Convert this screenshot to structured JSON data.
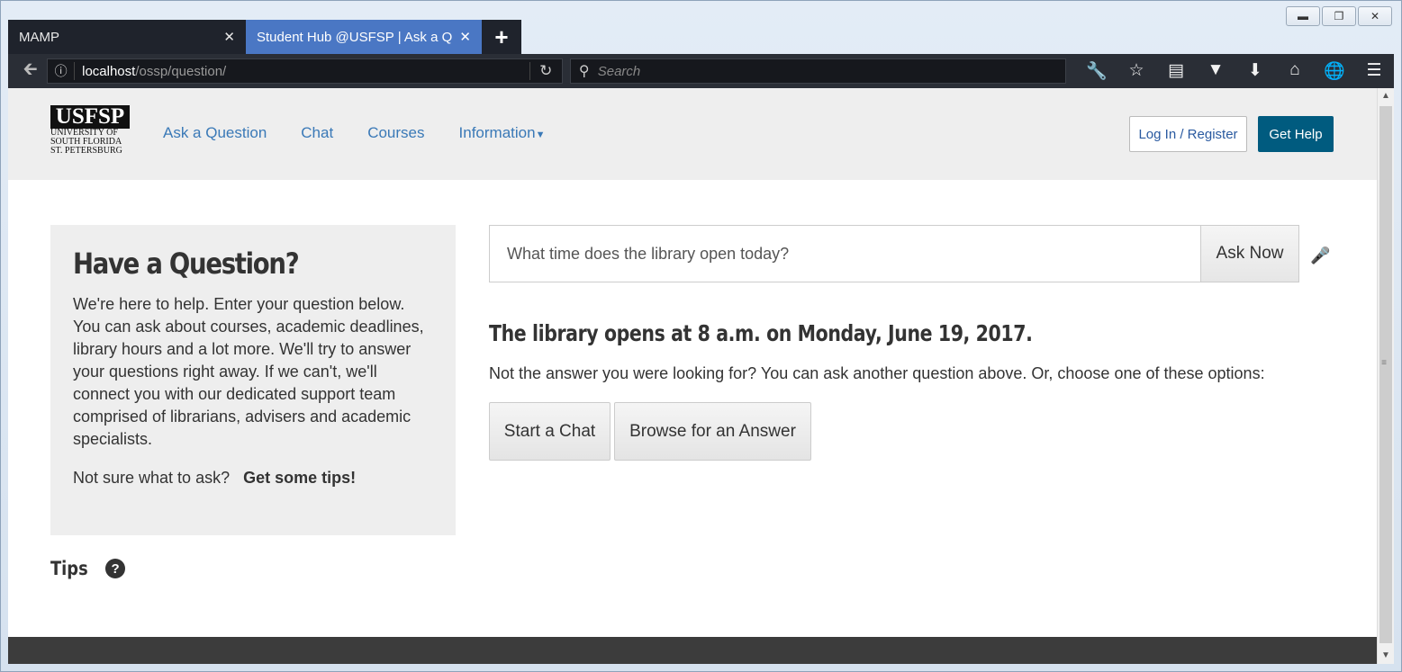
{
  "window": {
    "controls": [
      "minimize",
      "restore",
      "close"
    ]
  },
  "tabs": [
    {
      "label": "MAMP",
      "active": false
    },
    {
      "label": "Student Hub @USFSP | Ask a Question",
      "active": true
    }
  ],
  "navbar": {
    "url_host": "localhost",
    "url_path": "/ossp/question/",
    "search_placeholder": "Search"
  },
  "site": {
    "logo": {
      "word": "USFSP",
      "line1": "UNIVERSITY OF",
      "line2": "SOUTH FLORIDA",
      "line3": "ST. PETERSBURG"
    },
    "nav": [
      "Ask a Question",
      "Chat",
      "Courses",
      "Information"
    ],
    "login_label": "Log In / Register",
    "help_label": "Get Help"
  },
  "question_box": {
    "title": "Have a Question?",
    "body": "We're here to help. Enter your question below. You can ask about courses, academic deadlines, library hours and a lot more. We'll try to answer your questions right away. If we can't, we'll connect you with our dedicated support team comprised of librarians, advisers and academic specialists.",
    "tips_prompt": "Not sure what to ask?",
    "tips_link": "Get some tips!"
  },
  "tips_heading": "Tips",
  "ask": {
    "value": "What time does the library open today?",
    "button": "Ask Now"
  },
  "answer": {
    "text": "The library opens at 8 a.m. on Monday, June 19, 2017.",
    "followup": "Not the answer you were looking for? You can ask another question above. Or, choose one of these options:",
    "options": [
      "Start a Chat",
      "Browse for an Answer"
    ]
  },
  "colors": {
    "active_tab": "#4a77c4",
    "nav_link": "#3a79b7",
    "primary_button": "#005b7f",
    "footer": "#3c3c3c"
  }
}
